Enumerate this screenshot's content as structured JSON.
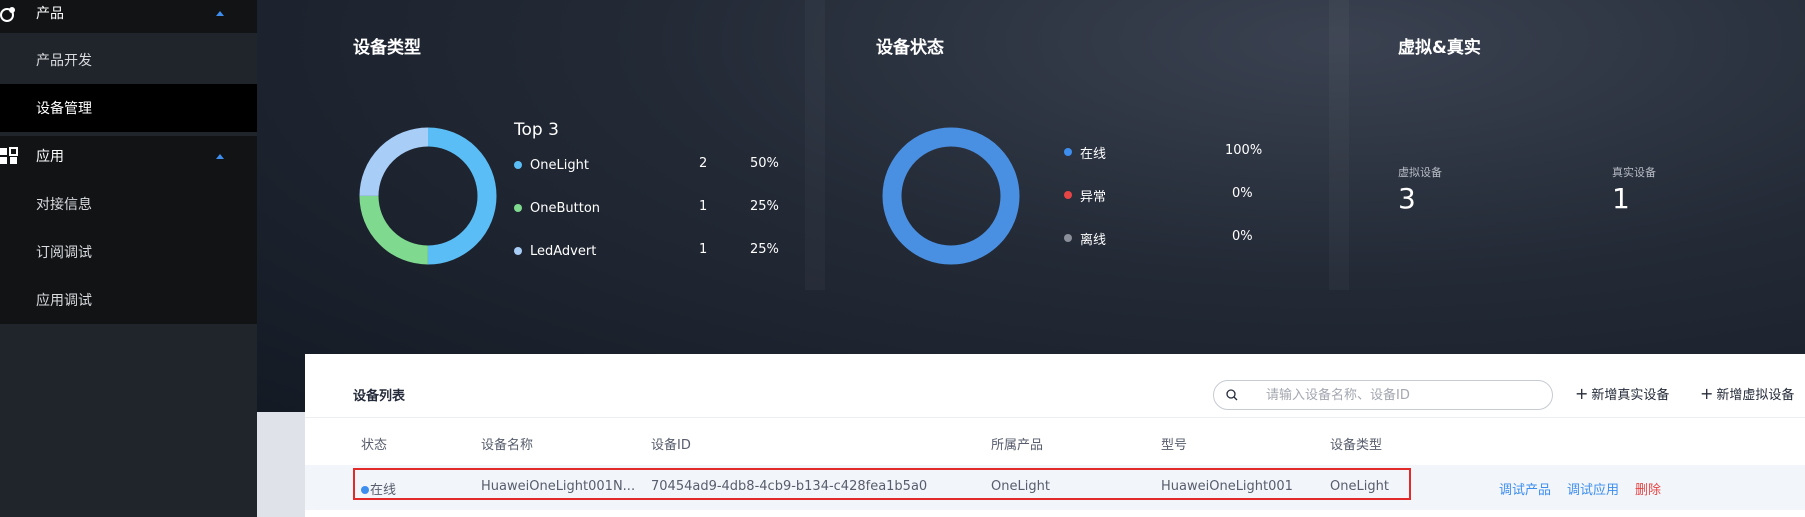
{
  "sidebar": {
    "groups": [
      {
        "label": "产品",
        "icon": "product-icon",
        "items": [
          {
            "label": "产品开发"
          },
          {
            "label": "设备管理",
            "active": true
          }
        ]
      },
      {
        "label": "应用",
        "icon": "app-grid-icon",
        "items": [
          {
            "label": "对接信息"
          },
          {
            "label": "订阅调试"
          },
          {
            "label": "应用调试"
          }
        ]
      }
    ]
  },
  "dashboard": {
    "device_type": {
      "title": "设备类型",
      "legend_title": "Top 3",
      "rows": [
        {
          "name": "OneLight",
          "count": "2",
          "percent": "50%",
          "color": "#5bbdf5"
        },
        {
          "name": "OneButton",
          "count": "1",
          "percent": "25%",
          "color": "#7fd98f"
        },
        {
          "name": "LedAdvert",
          "count": "1",
          "percent": "25%",
          "color": "#a8cdf7"
        }
      ]
    },
    "device_status": {
      "title": "设备状态",
      "rows": [
        {
          "name": "在线",
          "percent": "100%",
          "color": "#3d8eef"
        },
        {
          "name": "异常",
          "percent": "0%",
          "color": "#e64545"
        },
        {
          "name": "离线",
          "percent": "0%",
          "color": "#8a8e99"
        }
      ]
    },
    "virtual_real": {
      "title": "虚拟&真实",
      "virtual_label": "虚拟设备",
      "virtual_value": "3",
      "real_label": "真实设备",
      "real_value": "1"
    }
  },
  "device_list": {
    "title": "设备列表",
    "search_placeholder": "请输入设备名称、设备ID",
    "add_real_label": "新增真实设备",
    "add_virtual_label": "新增虚拟设备",
    "columns": [
      "状态",
      "设备名称",
      "设备ID",
      "所属产品",
      "型号",
      "设备类型"
    ],
    "rows": [
      {
        "status": "在线",
        "name": "HuaweiOneLight001N...",
        "id": "70454ad9-4db8-4cb9-b134-c428fea1b5a0",
        "product": "OneLight",
        "model": "HuaweiOneLight001",
        "type": "OneLight",
        "actions": {
          "debug_product": "调试产品",
          "debug_app": "调试应用",
          "delete": "删除"
        }
      }
    ]
  },
  "colors": {
    "accent": "#3d8eef",
    "danger": "#e22a2a",
    "sidebar_bg": "#20242b"
  }
}
